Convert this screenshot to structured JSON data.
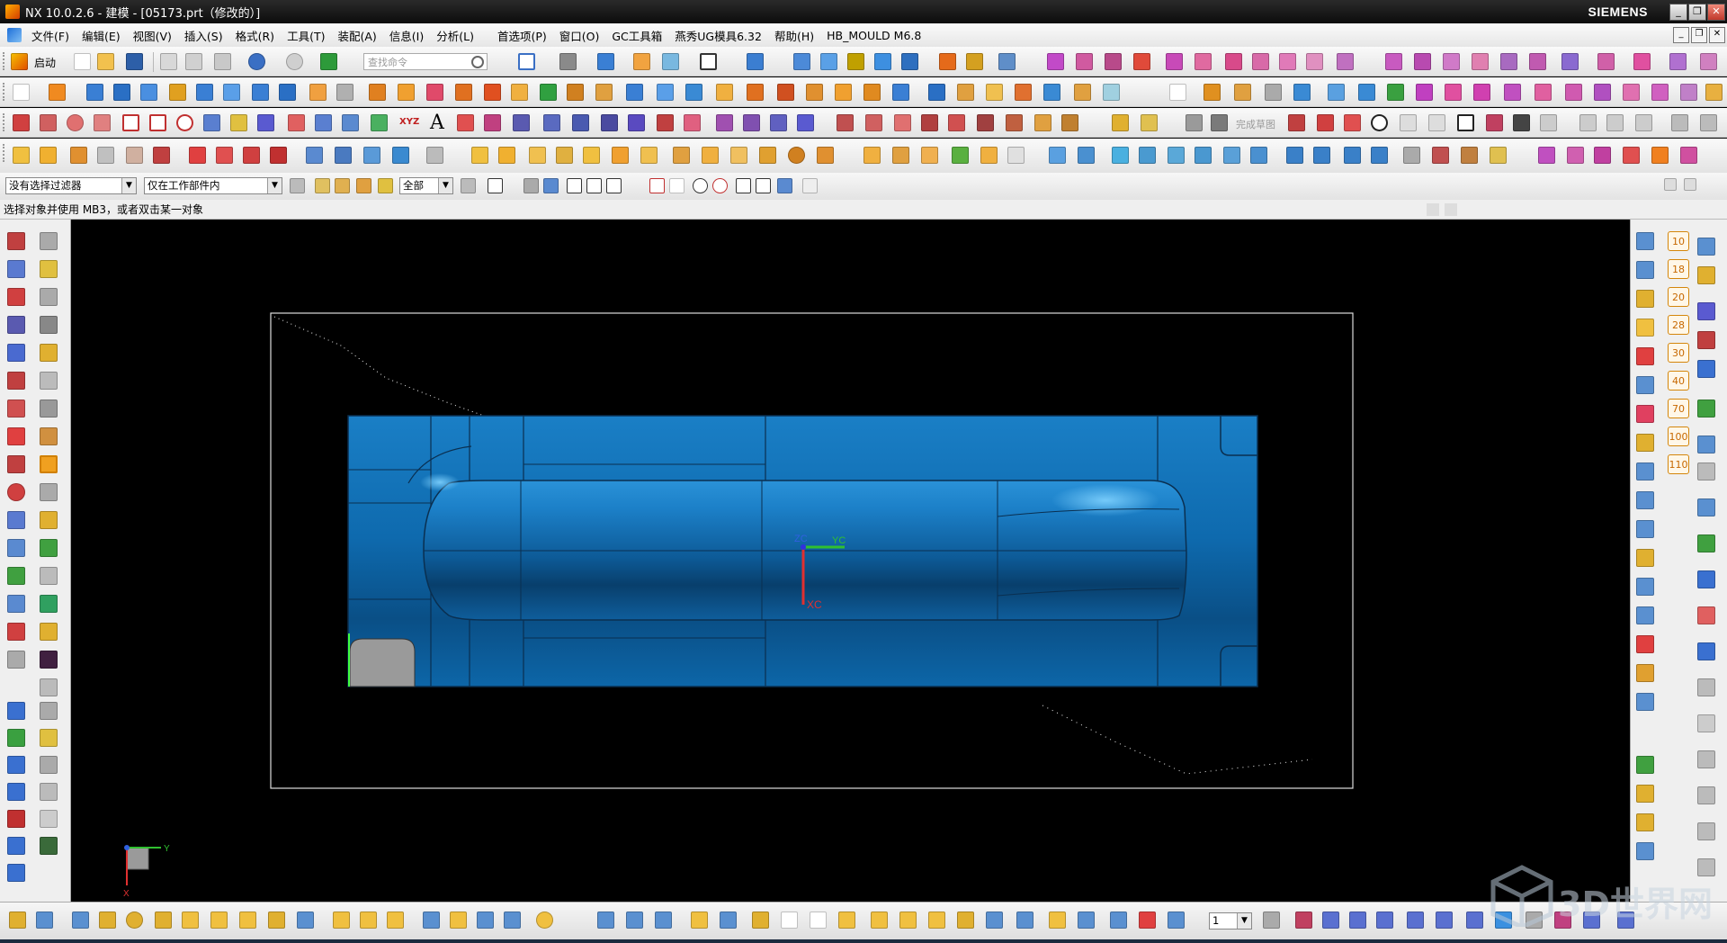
{
  "window": {
    "title": "NX 10.0.2.6 - 建模 - [05173.prt（修改的）]",
    "brand": "SIEMENS"
  },
  "menu": {
    "items": [
      "文件(F)",
      "编辑(E)",
      "视图(V)",
      "插入(S)",
      "格式(R)",
      "工具(T)",
      "装配(A)",
      "信息(I)",
      "分析(L)",
      "首选项(P)",
      "窗口(O)",
      "GC工具箱",
      "燕秀UG模具6.32",
      "帮助(H)",
      "HB_MOULD M6.8"
    ]
  },
  "toolbar": {
    "start_label": "启动",
    "search_placeholder": "查找命令",
    "sketch_finish_label": "完成草图",
    "text_tool_label": "A",
    "xyz_label": "XYZ"
  },
  "selection_bar": {
    "filter_value": "没有选择过滤器",
    "scope_value": "仅在工作部件内",
    "type_value": "全部"
  },
  "status": {
    "prompt": "选择对象并使用 MB3，或者双击某一对象"
  },
  "right_dock": {
    "numbers": [
      "10",
      "18",
      "20",
      "28",
      "30",
      "40",
      "70",
      "100",
      "110"
    ]
  },
  "bottom_bar": {
    "layer_value": "1"
  },
  "viewport": {
    "csys_label_xc": "XC",
    "csys_label_yc": "YC",
    "csys_label_zc": "ZC",
    "triad_y": "Y",
    "triad_x": "X"
  },
  "watermark": {
    "text": "3D世界网"
  },
  "colors": {
    "model_blue": "#0f6fb6",
    "model_highlight": "#48b4f0",
    "viewport_bg": "#000000",
    "accent_orange": "#d4860b"
  }
}
